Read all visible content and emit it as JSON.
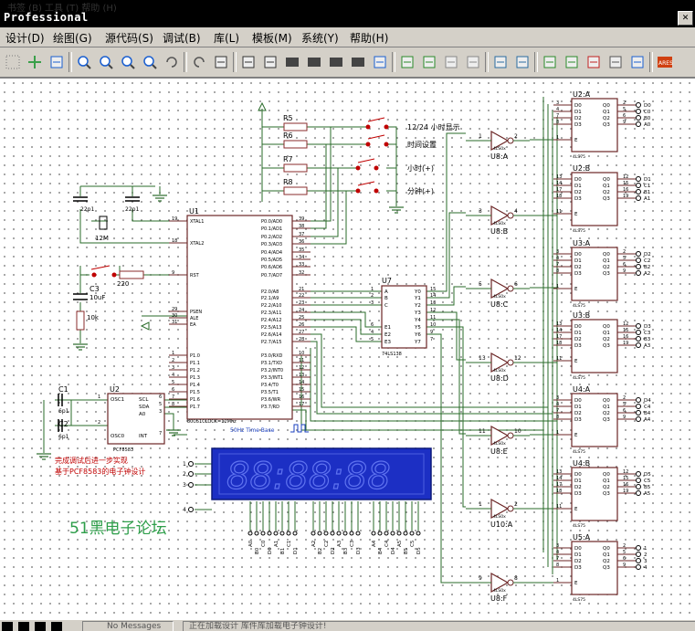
{
  "window": {
    "title": "Professional",
    "ghost_text": "书签 (B)   工具 (T)   帮助 (H)"
  },
  "menu": [
    "设计(D)",
    "绘图(G)",
    "源代码(S)",
    "调试(B)",
    "库(L)",
    "模板(M)",
    "系统(Y)",
    "帮助(H)"
  ],
  "toolbar": [
    "grid-icon",
    "origin-icon",
    "pan-icon",
    "zoom-in-icon",
    "zoom-out-icon",
    "zoom-all-icon",
    "zoom-area-icon",
    "undo-icon",
    "redo-icon",
    "cut-icon",
    "copy-icon",
    "paste-icon",
    "block-copy-icon",
    "block-move-icon",
    "block-rotate-icon",
    "block-delete-icon",
    "pick-device-icon",
    "make-device-icon",
    "packaging-icon",
    "decompose-icon",
    "wire-autorouter-icon",
    "search-tag-icon",
    "property-assign-icon",
    "new-sheet-icon",
    "add-sheet-icon",
    "remove-sheet-icon",
    "zoom-child-icon",
    "netlist-icon",
    "ares-icon"
  ],
  "schematic": {
    "resistors": [
      "R5",
      "R6",
      "R7",
      "R8"
    ],
    "button_labels": [
      "12/24 小时显示",
      "时间设置",
      "小时(+)",
      "分钟(+)"
    ],
    "c_small": "22p1",
    "crystal": "12M",
    "u1": {
      "ref": "U1",
      "part": "80C51CLOCK=12Mhz",
      "left": [
        "XTAL1",
        "XTAL2",
        "RST",
        "PSEN",
        "ALE",
        "EA",
        "P1.0",
        "P1.1",
        "P1.2",
        "P1.3",
        "P1.4",
        "P1.5",
        "P1.6",
        "P1.7"
      ],
      "left_pins": [
        "19",
        "18",
        "9",
        "29",
        "30",
        "31",
        "1",
        "2",
        "3",
        "4",
        "5",
        "6",
        "7",
        "8"
      ],
      "right": [
        "P0.0/AD0",
        "P0.1/AD1",
        "P0.2/AD2",
        "P0.3/AD3",
        "P0.4/AD4",
        "P0.5/AD5",
        "P0.6/AD6",
        "P0.7/AD7",
        "P2.0/A8",
        "P2.1/A9",
        "P2.2/A10",
        "P2.3/A11",
        "P2.4/A12",
        "P2.5/A13",
        "P2.6/A14",
        "P2.7/A15",
        "P3.0/RXD",
        "P3.1/TXD",
        "P3.2/INT0",
        "P3.3/INT1",
        "P3.4/T0",
        "P3.5/T1",
        "P3.6/WR",
        "P3.7/RD"
      ],
      "right_pins": [
        "39",
        "38",
        "37",
        "36",
        "35",
        "34",
        "33",
        "32",
        "21",
        "22",
        "23",
        "24",
        "25",
        "26",
        "27",
        "28",
        "10",
        "11",
        "12",
        "13",
        "14",
        "15",
        "16",
        "17"
      ]
    },
    "c3": {
      "ref": "C3",
      "value": "10uF"
    },
    "r220": "220",
    "r10k": "10k",
    "u7": {
      "ref": "U7",
      "part": "74LS138",
      "left": [
        "A",
        "B",
        "C",
        "E1",
        "E2",
        "E3"
      ],
      "left_pins": [
        "1",
        "2",
        "3",
        "6",
        "4",
        "5"
      ],
      "right": [
        "Y0",
        "Y1",
        "Y2",
        "Y3",
        "Y4",
        "Y5",
        "Y6",
        "Y7"
      ],
      "right_pins": [
        "15",
        "14",
        "13",
        "12",
        "11",
        "10",
        "9",
        "7"
      ]
    },
    "nots": [
      {
        "ref": "U8:A",
        "in": "1",
        "out": "2"
      },
      {
        "ref": "U8:B",
        "in": "3",
        "out": "4"
      },
      {
        "ref": "U8:C",
        "in": "5",
        "out": "6"
      },
      {
        "ref": "U8:D",
        "in": "13",
        "out": "12"
      },
      {
        "ref": "U8:E",
        "in": "11",
        "out": "10"
      },
      {
        "ref": "U10:A",
        "in": "1",
        "out": "2"
      },
      {
        "ref": "U8:F",
        "in": "9",
        "out": "8"
      }
    ],
    "not_part": "4LS0x",
    "latches": [
      {
        "ref": "U2:A",
        "d": [
          "3",
          "4",
          "7",
          "8"
        ],
        "q": [
          "2",
          "5",
          "6",
          "9"
        ],
        "e": "1",
        "outs": [
          "D0",
          "C0",
          "B0",
          "A0"
        ]
      },
      {
        "ref": "U2:B",
        "d": [
          "13",
          "14",
          "17",
          "18"
        ],
        "q": [
          "12",
          "15",
          "16",
          "19"
        ],
        "e": "11",
        "outs": [
          "D1",
          "C1",
          "B1",
          "A1"
        ]
      },
      {
        "ref": "U3:A",
        "d": [
          "3",
          "4",
          "7",
          "8"
        ],
        "q": [
          "2",
          "5",
          "6",
          "9"
        ],
        "e": "1",
        "outs": [
          "D2",
          "C2",
          "B2",
          "A2"
        ]
      },
      {
        "ref": "U3:B",
        "d": [
          "13",
          "14",
          "17",
          "18"
        ],
        "q": [
          "12",
          "15",
          "16",
          "19"
        ],
        "e": "11",
        "outs": [
          "D3",
          "C3",
          "B3",
          "A3"
        ]
      },
      {
        "ref": "U4:A",
        "d": [
          "3",
          "4",
          "7",
          "8"
        ],
        "q": [
          "2",
          "5",
          "6",
          "9"
        ],
        "e": "1",
        "outs": [
          "D4",
          "C4",
          "B4",
          "A4"
        ]
      },
      {
        "ref": "U4:B",
        "d": [
          "13",
          "14",
          "17",
          "18"
        ],
        "q": [
          "12",
          "15",
          "16",
          "19"
        ],
        "e": "11",
        "outs": [
          "D5",
          "C5",
          "B5",
          "A5"
        ]
      },
      {
        "ref": "U5:A",
        "d": [
          "3",
          "4",
          "7",
          "8"
        ],
        "q": [
          "2",
          "5",
          "6",
          "9"
        ],
        "e": "1",
        "outs": [
          "1",
          "2",
          "3",
          "4"
        ]
      }
    ],
    "latch_pins": [
      "D0",
      "D1",
      "D2",
      "D3",
      "Q0",
      "Q1",
      "Q2",
      "Q3",
      "E"
    ],
    "latch_part": "4LS75",
    "u2": {
      "ref": "U2",
      "part": "PCF8583",
      "pins": [
        "OSC1",
        "OSC0",
        "SCL",
        "SDA",
        "A0",
        "INT"
      ],
      "pin_nums": [
        "1",
        "2",
        "6",
        "5",
        "3",
        "7"
      ]
    },
    "c1": {
      "ref": "C1",
      "value": "6p1"
    },
    "c2": {
      "ref": "C2",
      "value": "6p1"
    },
    "clock_label": "50Hz Time Base",
    "note_lines": [
      "完成调试后进一步实现",
      "基于PCF8583的电子钟设计"
    ],
    "display_digits": "88:88:88",
    "display_inputs": [
      "1",
      "2",
      "3",
      "4"
    ],
    "bottom_labels": [
      "A0",
      "B0",
      "C0",
      "D0",
      "A1",
      "B1",
      "C1",
      "D1",
      "A2",
      "B2",
      "C2",
      "D2",
      "A3",
      "B3",
      "C3",
      "D3",
      "A4",
      "B4",
      "C4",
      "D4",
      "A5",
      "B5",
      "C5",
      "D5"
    ],
    "watermark": "51黑电子论坛"
  },
  "status": {
    "message": "No Messages",
    "text": "正在加载设计 库件库加载电子钟设计!"
  }
}
